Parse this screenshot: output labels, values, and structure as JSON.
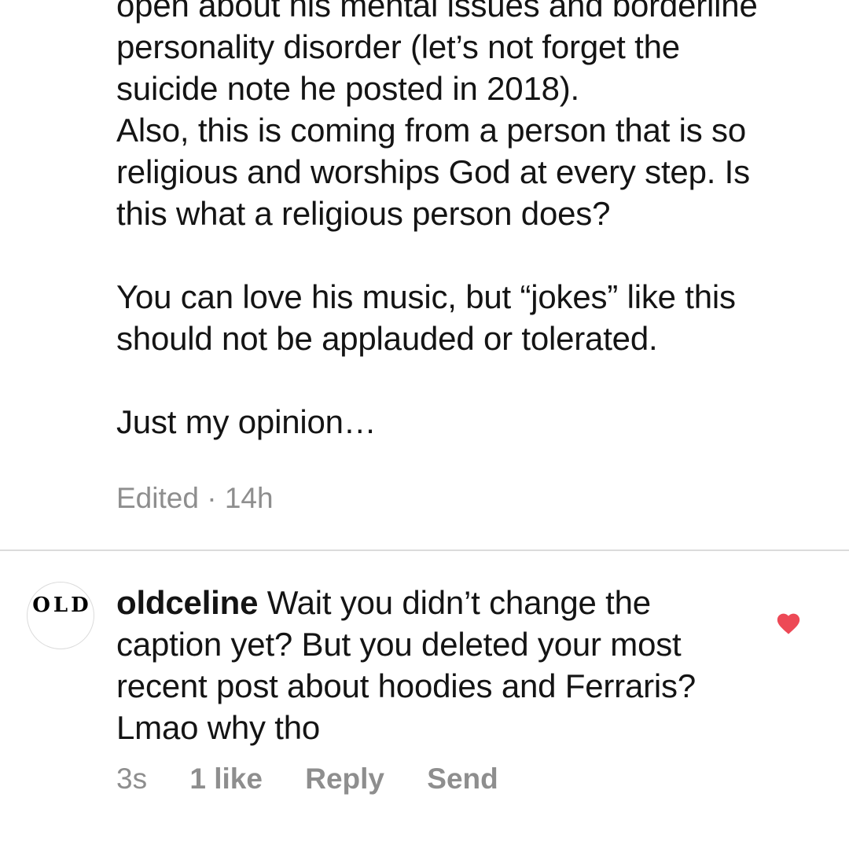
{
  "first_comment": {
    "text": "open about his mental issues and borderline\npersonality disorder (let’s not forget the\nsuicide note he posted in 2018).\nAlso, this is coming from a person that is so\nreligious and worships God at every step. Is\nthis what a religious person does?\n\nYou can love his music, but “jokes” like this\nshould not be applauded or tolerated.\n\nJust my opinion…",
    "edited_label": "Edited",
    "separator": "·",
    "time": "14h"
  },
  "second_comment": {
    "avatar_text": "OLD",
    "username": "oldceline",
    "text": "Wait you didn’t change the caption yet? But you deleted your most recent post about hoodies and Ferraris? Lmao why tho",
    "time": "3s",
    "likes": "1 like",
    "reply_label": "Reply",
    "send_label": "Send",
    "liked": true,
    "heart_color": "#ed4956",
    "heart_icon": "heart-filled-icon"
  },
  "colors": {
    "text": "#141414",
    "muted": "#8e8e8e",
    "divider": "#dbdbdb"
  }
}
